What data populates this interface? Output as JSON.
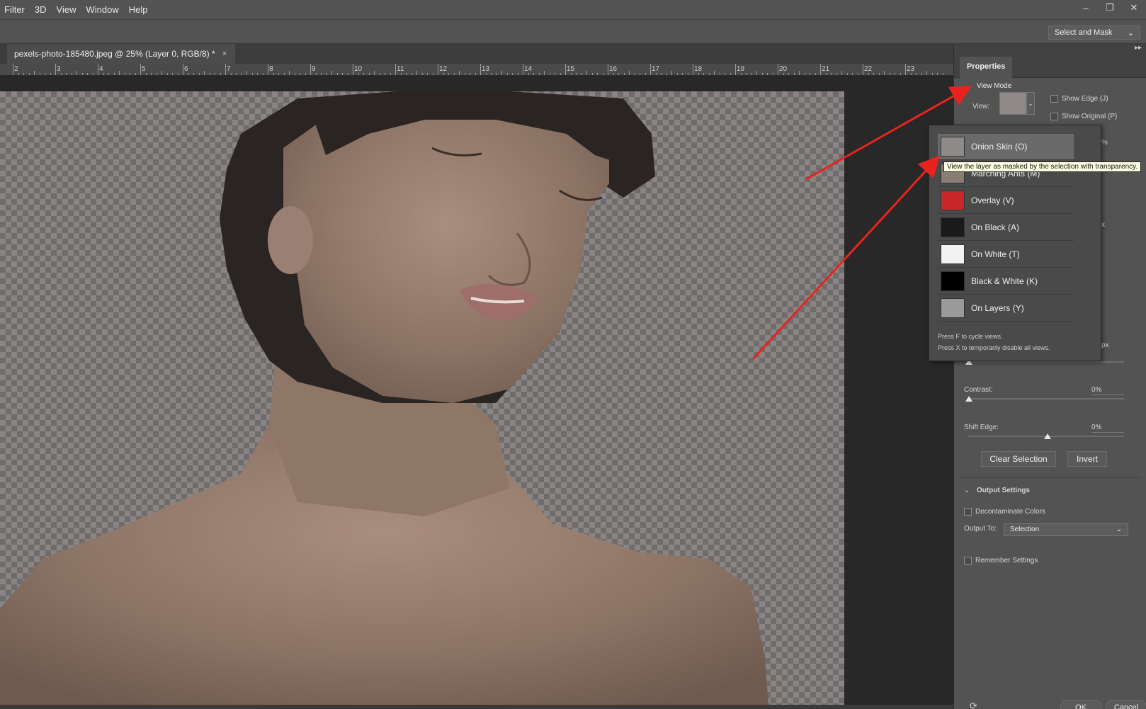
{
  "menu": [
    "Filter",
    "3D",
    "View",
    "Window",
    "Help"
  ],
  "window_controls": {
    "minimize": "–",
    "restore": "❐",
    "close": "✕"
  },
  "options_bar": {
    "select_and_mask": "Select and Mask"
  },
  "document_tab": {
    "title": "pexels-photo-185480.jpeg @ 25% (Layer 0, RGB/8) *",
    "close": "×"
  },
  "ruler": {
    "labels": [
      "2",
      "3",
      "4",
      "5",
      "6",
      "7",
      "8",
      "9",
      "10",
      "11",
      "12",
      "13",
      "14",
      "15",
      "16",
      "17",
      "18",
      "19",
      "20",
      "21",
      "22",
      "23"
    ]
  },
  "panel": {
    "collapse": "▸▸",
    "tab": "Properties",
    "view_mode": {
      "heading": "View Mode",
      "view_label": "View:",
      "show_edge": "Show Edge (J)",
      "show_original": "Show Original (P)"
    },
    "partial_values": {
      "v1": "%",
      "v2": "x",
      "v3": "px"
    },
    "contrast": {
      "label": "Contrast:",
      "value": "0%"
    },
    "shift_edge": {
      "label": "Shift Edge:",
      "value": "0%"
    },
    "clear_selection": "Clear Selection",
    "invert": "Invert",
    "output_settings": {
      "heading": "Output Settings",
      "decontaminate": "Decontaminate Colors",
      "output_to_label": "Output To:",
      "output_to_value": "Selection"
    },
    "remember_settings": "Remember Settings",
    "ok": "OK",
    "cancel": "Cancel"
  },
  "view_dropdown": {
    "items": [
      {
        "label": "Onion Skin (O)",
        "thumb": "onion-skin-icon",
        "color": "#8e8a88"
      },
      {
        "label": "Marching Ants (M)",
        "thumb": "marching-ants-icon",
        "color": "#8a7d74"
      },
      {
        "label": "Overlay (V)",
        "thumb": "overlay-icon",
        "color": "#c8282a"
      },
      {
        "label": "On Black (A)",
        "thumb": "on-black-icon",
        "color": "#1a1a1a"
      },
      {
        "label": "On White (T)",
        "thumb": "on-white-icon",
        "color": "#f2f2f2"
      },
      {
        "label": "Black & White (K)",
        "thumb": "black-white-icon",
        "color": "#000000"
      },
      {
        "label": "On Layers (Y)",
        "thumb": "on-layers-icon",
        "color": "#9a9a9a"
      }
    ],
    "note_1": "Press F to cycle views.",
    "note_2": "Press X to temporarily disable all views.",
    "tooltip": "View the layer as masked by the selection with transparency."
  },
  "annotation_color": "#e8231e"
}
